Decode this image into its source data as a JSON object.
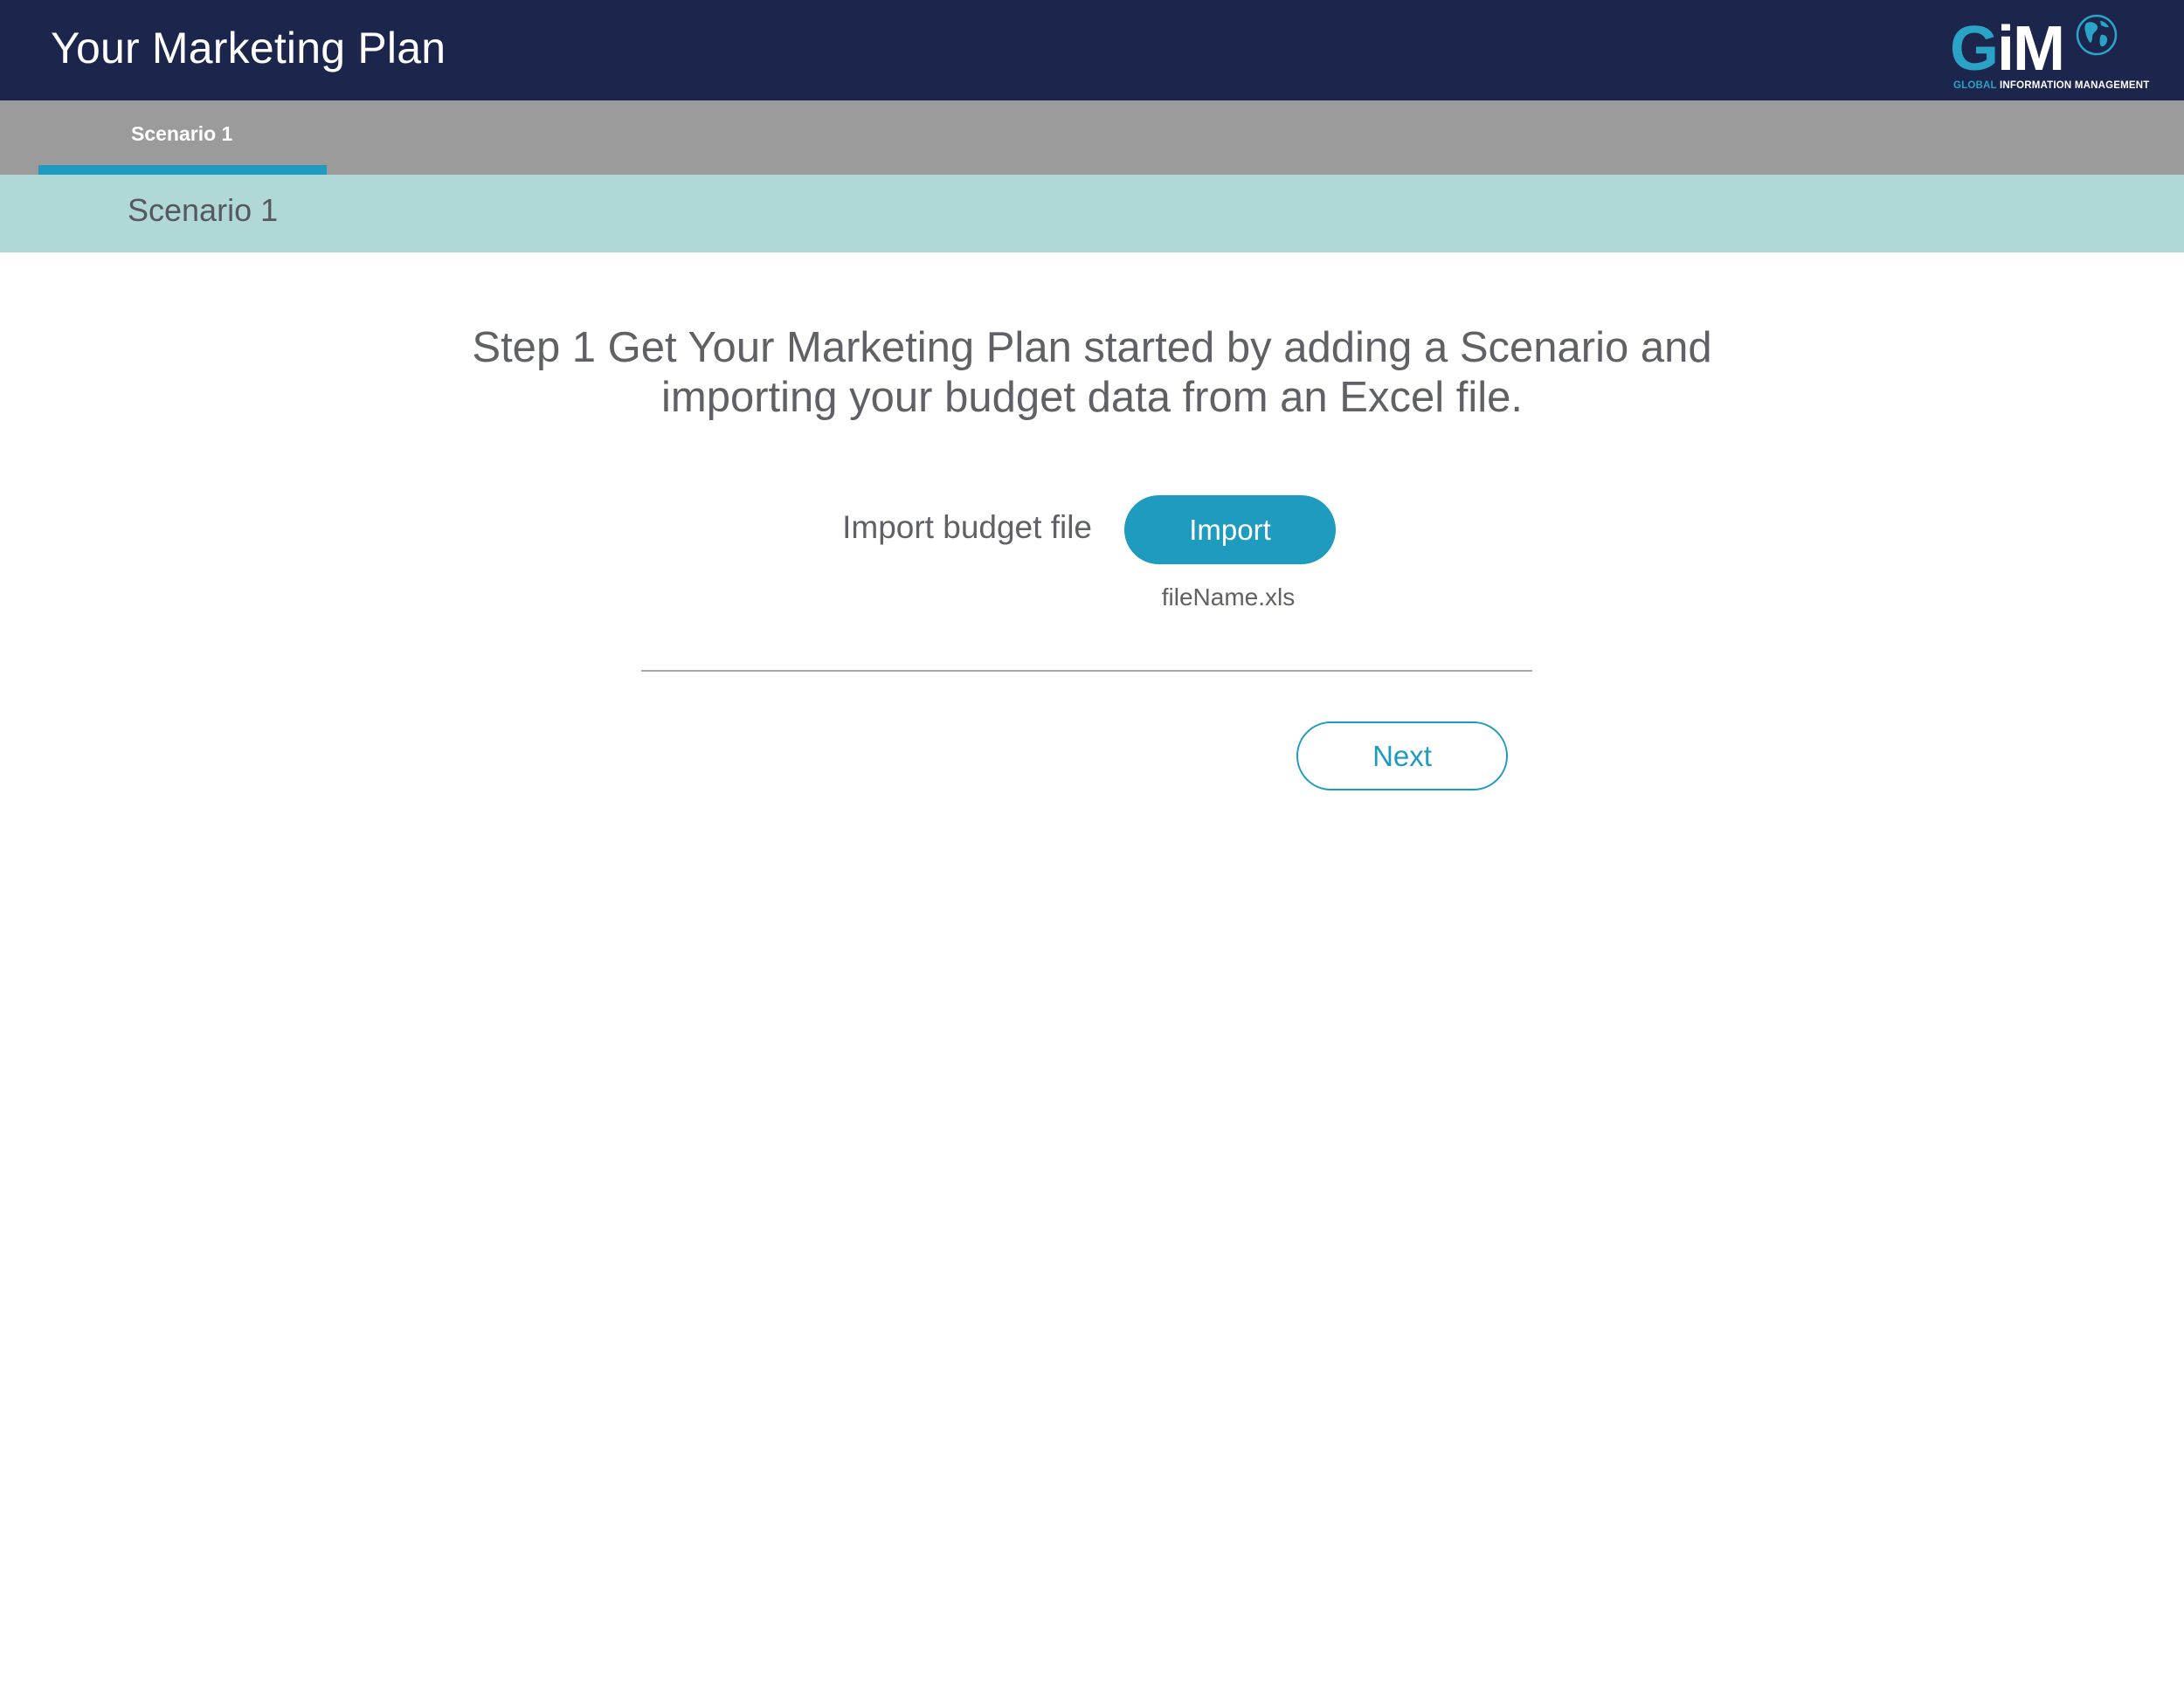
{
  "header": {
    "title": "Your Marketing Plan",
    "logo": {
      "mark_g": "G",
      "mark_im": "iM",
      "tagline_global": "GLOBAL",
      "tagline_rest": "INFORMATION MANAGEMENT",
      "icon": "globe-icon"
    }
  },
  "tabs": [
    {
      "label": "Scenario 1",
      "active": true
    }
  ],
  "section": {
    "title": "Scenario 1"
  },
  "main": {
    "instructions": "Step 1 Get Your Marketing Plan started by adding a Scenario and importing your budget data from an Excel file.",
    "import_label": "Import budget file",
    "import_button": "Import",
    "file_name": "fileName.xls",
    "next_button": "Next"
  },
  "colors": {
    "header_bg": "#1c254c",
    "tabbar_bg": "#9b9b9b",
    "accent": "#1f9bbf",
    "section_bg": "#b0d8d6",
    "text": "#5f6166"
  }
}
